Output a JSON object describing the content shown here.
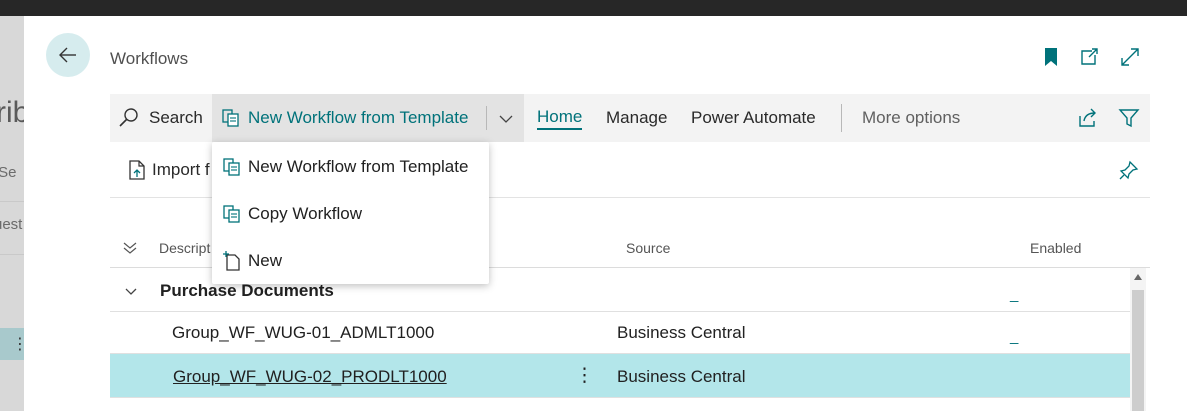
{
  "background_page": {
    "title_fragment": "rib",
    "path_fragment": "/Se",
    "row_fragment": "uest",
    "row_menu_glyph": "⋮"
  },
  "header": {
    "title": "Workflows",
    "icons": [
      "back-arrow-icon",
      "bookmark-icon",
      "open-new-window-icon",
      "expand-icon"
    ]
  },
  "actionbar": {
    "search_label": "Search",
    "new_from_template_label": "New Workflow from Template",
    "home_label": "Home",
    "manage_label": "Manage",
    "power_automate_label": "Power Automate",
    "more_options_label": "More options"
  },
  "subbar": {
    "import_label": "Import f"
  },
  "dropdown": {
    "items": [
      {
        "label": "New Workflow from Template",
        "icon": "copy-doc-icon"
      },
      {
        "label": "Copy Workflow",
        "icon": "copy-doc-icon"
      },
      {
        "label": "New",
        "icon": "new-doc-icon"
      }
    ]
  },
  "grid": {
    "columns": {
      "description": "Descript",
      "source": "Source",
      "enabled": "Enabled"
    },
    "group": {
      "label": "Purchase Documents",
      "enabled": "_"
    },
    "rows": [
      {
        "description": "Group_WF_WUG-01_ADMLT1000",
        "source": "Business Central",
        "enabled": "_"
      },
      {
        "description": "Group_WF_WUG-02_PRODLT1000",
        "source": "Business Central",
        "row_menu": "⋮"
      }
    ]
  },
  "colors": {
    "accent": "#00727a",
    "selected_row": "#b3e6ea",
    "actionbar_bg": "#f3f3f3"
  }
}
